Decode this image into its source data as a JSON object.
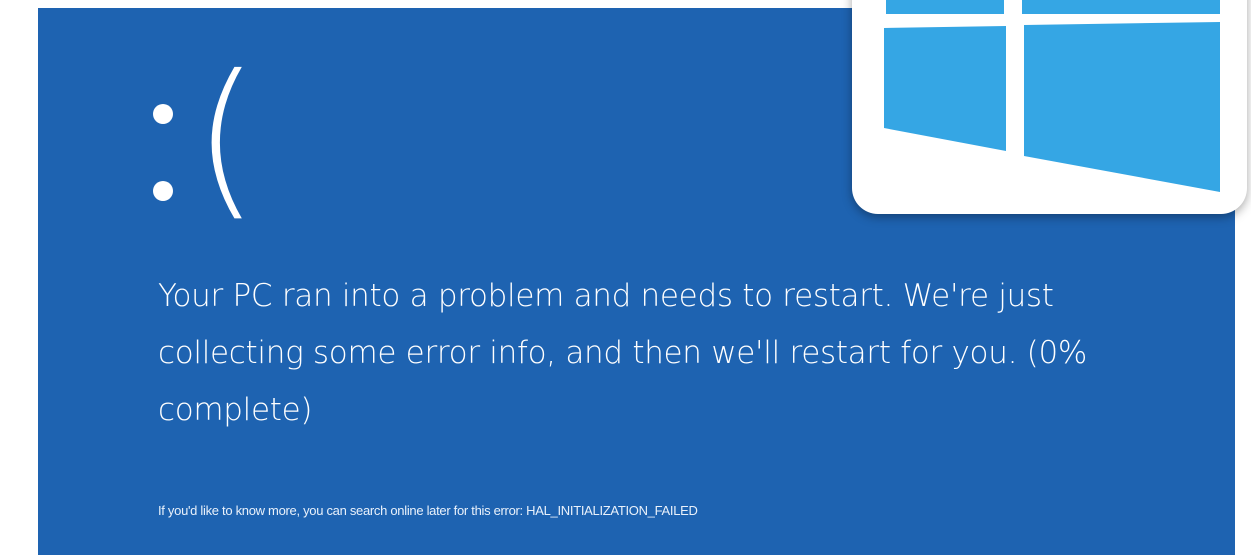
{
  "screen": {
    "background_color": "#1e63b1",
    "frown_face": ":(",
    "message": "Your PC ran into a problem and needs to restart. We're just collecting some error info, and then we'll restart for you. (0% complete)",
    "progress_percent": 0,
    "info_text": "If you'd like to know more, you can search online later for this error: HAL_INITIALIZATION_FAILED"
  },
  "logo": {
    "icon": "windows-logo-icon",
    "tile_color": "#35a6e4"
  }
}
